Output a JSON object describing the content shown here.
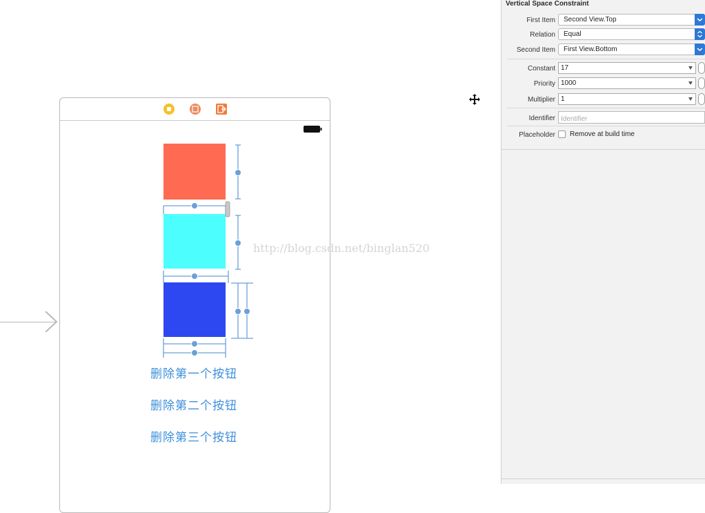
{
  "watermark": "http://blog.csdn.net/binglan520",
  "canvas": {
    "delete_buttons": [
      "删除第一个按钮",
      "删除第二个按钮",
      "删除第三个按钮"
    ],
    "colors": {
      "red_view": "#ff6a52",
      "cyan_view": "#4cfefe",
      "blue_view": "#2d48f0",
      "constraint": "#6ba0d8",
      "button_text": "#3d8fdc"
    }
  },
  "inspector": {
    "title": "Vertical Space Constraint",
    "first_item": {
      "label": "First Item",
      "value": "Second View.Top"
    },
    "relation": {
      "label": "Relation",
      "value": "Equal"
    },
    "second_item": {
      "label": "Second Item",
      "value": "First View.Bottom"
    },
    "constant": {
      "label": "Constant",
      "value": "17"
    },
    "priority": {
      "label": "Priority",
      "value": "1000"
    },
    "multiplier": {
      "label": "Multiplier",
      "value": "1"
    },
    "identifier": {
      "label": "Identifier",
      "placeholder": "Identifier"
    },
    "placeholder": {
      "label": "Placeholder",
      "checkbox_label": "Remove at build time",
      "checked": false
    }
  }
}
